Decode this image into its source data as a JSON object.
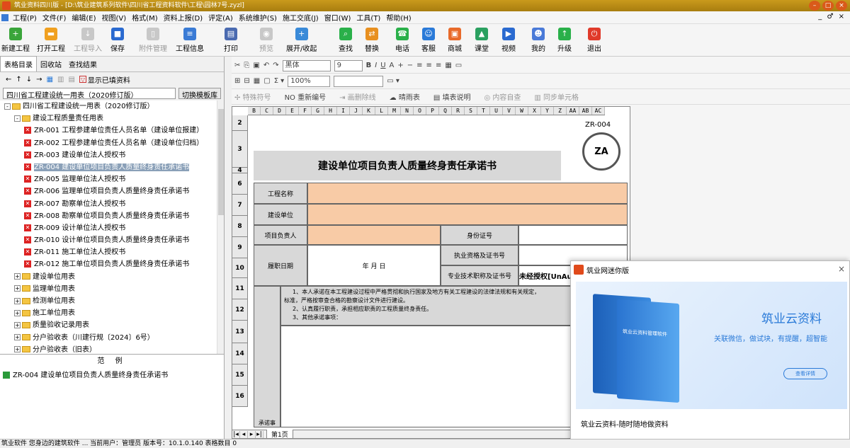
{
  "window": {
    "title": "筑业资料四川版 - [D:\\筑业建筑系列软件\\四川省工程资料软件\\工程\\园林7号.zyzl]",
    "buttons": [
      "–",
      "□",
      "×"
    ]
  },
  "menu": [
    "工程(P)",
    "文件(F)",
    "编辑(E)",
    "视图(V)",
    "格式(M)",
    "资料上报(D)",
    "评定(A)",
    "系统维护(S)",
    "施工交底(J)",
    "窗口(W)",
    "工具(T)",
    "帮助(H)"
  ],
  "menu_right": "_ ♂ ×",
  "toolbar": [
    {
      "label": "新建工程",
      "color": "#3aa53a",
      "glyph": "+"
    },
    {
      "label": "打开工程",
      "color": "#f0a020",
      "glyph": "▬"
    },
    {
      "label": "工程导入",
      "color": "",
      "glyph": "↓",
      "disabled": true
    },
    {
      "label": "保存",
      "color": "#2a6ad0",
      "glyph": "■"
    },
    {
      "label": "附件管理",
      "color": "",
      "glyph": "▯",
      "disabled": true
    },
    {
      "label": "工程信息",
      "color": "#3a7bd5",
      "glyph": "≡"
    },
    {
      "label": "打印",
      "color": "#4a6ab0",
      "glyph": "▤"
    },
    {
      "label": "预览",
      "color": "",
      "glyph": "◉",
      "disabled": true
    },
    {
      "label": "展开/收起",
      "color": "#3a8ad8",
      "glyph": "+"
    },
    {
      "label": "查找",
      "color": "#2ab04a",
      "glyph": "⌕"
    },
    {
      "label": "替换",
      "color": "#e89020",
      "glyph": "⇄"
    },
    {
      "label": "电话",
      "color": "#2ab04a",
      "glyph": "☎"
    },
    {
      "label": "客服",
      "color": "#2a7ad8",
      "glyph": "☺"
    },
    {
      "label": "商城",
      "color": "#e86a2a",
      "glyph": "▣"
    },
    {
      "label": "课堂",
      "color": "#2aa060",
      "glyph": "▲"
    },
    {
      "label": "视频",
      "color": "#2a6ad0",
      "glyph": "▶"
    },
    {
      "label": "我的",
      "color": "#4a7ad8",
      "glyph": "☻"
    },
    {
      "label": "升级",
      "color": "#2ab04a",
      "glyph": "↑"
    },
    {
      "label": "退出",
      "color": "#e03a2a",
      "glyph": "⏻"
    }
  ],
  "left": {
    "tabs": [
      "表格目录",
      "回收站",
      "查找结果"
    ],
    "show_filled": "显示已填资料",
    "combo": "四川省工程建设统一用表（2020修订版）",
    "switch_btn": "切换模板库",
    "tree": [
      {
        "level": 0,
        "pm": "-",
        "folder": true,
        "text": "四川省工程建设统一用表（2020修订版）"
      },
      {
        "level": 1,
        "pm": "-",
        "folder": true,
        "text": "建设工程质量责任用表"
      },
      {
        "level": 2,
        "x": true,
        "text": "ZR-001 工程参建单位责任人员名单（建设单位报建）"
      },
      {
        "level": 2,
        "x": true,
        "text": "ZR-002 工程参建单位责任人员名单（建设单位归档）"
      },
      {
        "level": 2,
        "x": true,
        "text": "ZR-003 建设单位法人授权书"
      },
      {
        "level": 2,
        "x": true,
        "text": "ZR-004 建设单位项目负责人质量终身责任承诺书",
        "selected": true
      },
      {
        "level": 2,
        "x": true,
        "text": "ZR-005 监理单位法人授权书"
      },
      {
        "level": 2,
        "x": true,
        "text": "ZR-006 监理单位项目负责人质量终身责任承诺书"
      },
      {
        "level": 2,
        "x": true,
        "text": "ZR-007 勘察单位法人授权书"
      },
      {
        "level": 2,
        "x": true,
        "text": "ZR-008 勘察单位项目负责人质量终身责任承诺书"
      },
      {
        "level": 2,
        "x": true,
        "text": "ZR-009 设计单位法人授权书"
      },
      {
        "level": 2,
        "x": true,
        "text": "ZR-010 设计单位项目负责人质量终身责任承诺书"
      },
      {
        "level": 2,
        "x": true,
        "text": "ZR-011 施工单位法人授权书"
      },
      {
        "level": 2,
        "x": true,
        "text": "ZR-012 施工单位项目负责人质量终身责任承诺书"
      },
      {
        "level": 1,
        "pm": "+",
        "folder": true,
        "text": "建设单位用表"
      },
      {
        "level": 1,
        "pm": "+",
        "folder": true,
        "text": "监理单位用表"
      },
      {
        "level": 1,
        "pm": "+",
        "folder": true,
        "text": "检测单位用表"
      },
      {
        "level": 1,
        "pm": "+",
        "folder": true,
        "text": "施工单位用表"
      },
      {
        "level": 1,
        "pm": "+",
        "folder": true,
        "text": "质量验收记录用表"
      },
      {
        "level": 1,
        "pm": "+",
        "folder": true,
        "text": "分户验收表（川建行规〔2024〕6号）"
      },
      {
        "level": 1,
        "pm": "+",
        "folder": true,
        "text": "分户验收表（旧表）"
      }
    ],
    "sample_header": "范 例",
    "sample_item": "ZR-004 建设单位项目负责人质量终身责任承诺书"
  },
  "editor": {
    "font_name": "黑体",
    "font_size": "9",
    "zoom": "100%",
    "row3": [
      {
        "t": "✢ 特殊符号",
        "g": true
      },
      {
        "t": "NO 重新编号",
        "g": false
      },
      {
        "t": "⇥ 画删除线",
        "g": true
      },
      {
        "t": "☁ 晴雨表",
        "g": false
      },
      {
        "t": "▤ 填表说明",
        "g": false
      },
      {
        "t": "◎ 内容自查",
        "g": true
      },
      {
        "t": "▥ 同步单元格",
        "g": true
      }
    ],
    "cols": [
      "B",
      "C",
      "D",
      "E",
      "F",
      "G",
      "H",
      "I",
      "J",
      "K",
      "L",
      "M",
      "N",
      "O",
      "P",
      "Q",
      "R",
      "S",
      "T",
      "U",
      "V",
      "W",
      "X",
      "Y",
      "Z",
      "AA",
      "AB",
      "AC"
    ],
    "rows": [
      "2",
      "3",
      "4",
      "6",
      "7",
      "8",
      "9",
      "10",
      "11",
      "12",
      "13",
      "14",
      "15",
      "16"
    ],
    "doc_no": "ZR-004",
    "logo_text": "ZA",
    "form_title": "建设单位项目负责人质量终身责任承诺书",
    "labels": {
      "project_name": "工程名称",
      "build_unit": "建设单位",
      "leader": "项目负责人",
      "id_no": "身份证号",
      "appoint_date": "履职日期",
      "date_text": "年  月  日",
      "qual_cert": "执业资格及证书号",
      "tech_title": "专业技术职称及证书号",
      "pledge_side": "承诺事"
    },
    "unauthorized": "未经授权[UnAuthorize",
    "pledge": [
      "1、本人承诺在本工程建设过程中严格贯彻和执行国家及地方有关工程建设的法律法规和有关规定，",
      "标准，严格按审查合格的勘察设计文件进行建设。",
      "2、认真履行职责，承担相应职责的工程质量终身责任。",
      "3、其他承诺事项："
    ],
    "sheet_tab": "第1页"
  },
  "popup": {
    "title": "筑业网迷你版",
    "close": "×",
    "brand": "筑业云资料",
    "slogan": "关联微信，做试块，有提醒，超智能",
    "btn": "查看详情",
    "box_text": "筑业云资料管理软件",
    "footer": "筑业云资料-随时随地做资料"
  },
  "status": "筑业软件 您身边的建筑软件      ...    当前用户：管理员    版本号：10.1.0.140    表格数目 0"
}
